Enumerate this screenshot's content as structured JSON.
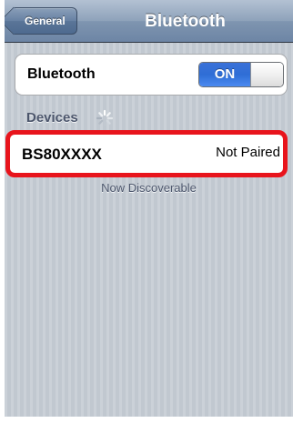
{
  "navbar": {
    "back_label": "General",
    "title": "Bluetooth"
  },
  "bluetooth_row": {
    "label": "Bluetooth",
    "toggle_state": "ON"
  },
  "devices_section": {
    "header": "Devices",
    "items": [
      {
        "name": "BS80XXXX",
        "status": "Not Paired"
      }
    ],
    "footer": "Now Discoverable"
  },
  "colors": {
    "highlight_border": "#e8141c",
    "toggle_on": "#2f6ed6",
    "background": "#c5ccd4",
    "section_text": "#4c566c"
  }
}
